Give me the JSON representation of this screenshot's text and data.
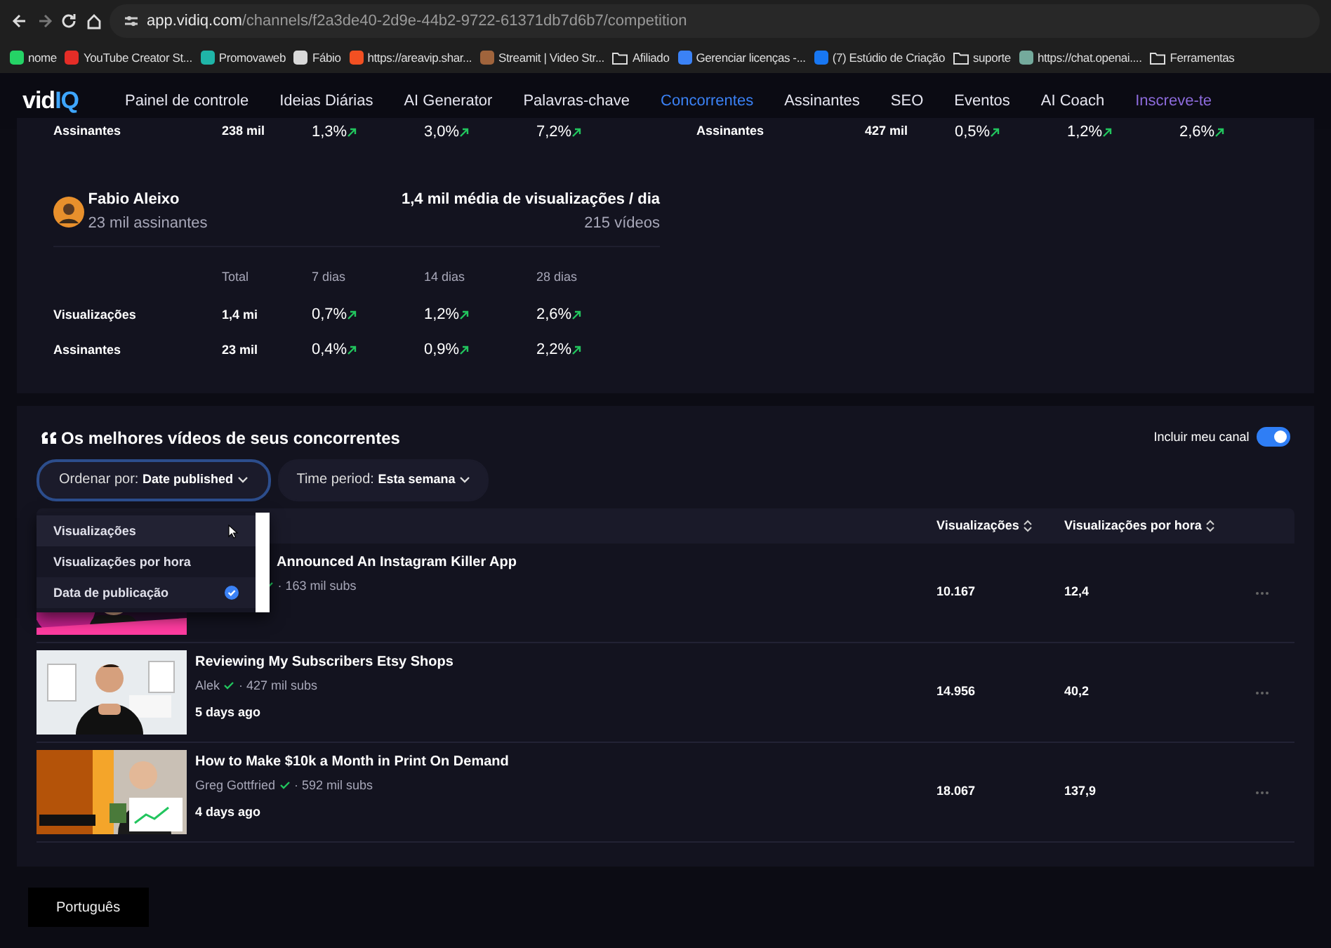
{
  "browser": {
    "url_host": "app.vidiq.com",
    "url_path": "/channels/f2a3de40-2d9e-44b2-9722-61371db7d6b7/competition"
  },
  "bookmarks": [
    {
      "label": "nome",
      "kind": "site",
      "color": "#25d366"
    },
    {
      "label": "YouTube Creator St...",
      "kind": "site",
      "color": "#e52d27"
    },
    {
      "label": "Promovaweb",
      "kind": "site",
      "color": "#1fb5a8"
    },
    {
      "label": "Fábio",
      "kind": "site",
      "color": "#d9d9d9"
    },
    {
      "label": "https://areavip.shar...",
      "kind": "site",
      "color": "#f25022"
    },
    {
      "label": "Streamit | Video Str...",
      "kind": "site",
      "color": "#a0643c"
    },
    {
      "label": "Afiliado",
      "kind": "folder"
    },
    {
      "label": "Gerenciar licenças -...",
      "kind": "site",
      "color": "#3b82f6"
    },
    {
      "label": "(7) Estúdio de Criação",
      "kind": "site",
      "color": "#1877f2"
    },
    {
      "label": "suporte",
      "kind": "folder"
    },
    {
      "label": "https://chat.openai....",
      "kind": "site",
      "color": "#74aa9c"
    },
    {
      "label": "Ferramentas",
      "kind": "folder"
    }
  ],
  "app": {
    "logo_main": "vid",
    "logo_accent": "IQ",
    "nav": [
      {
        "label": "Painel de controle",
        "kind": "link",
        "selected": false
      },
      {
        "label": "Ideias Diárias",
        "kind": "link",
        "selected": false
      },
      {
        "label": "AI Generator",
        "kind": "link",
        "selected": false
      },
      {
        "label": "Palavras-chave",
        "kind": "link",
        "selected": false
      },
      {
        "label": "Concorrentes",
        "kind": "link",
        "selected": true
      },
      {
        "label": "Assinantes",
        "kind": "link",
        "selected": false
      },
      {
        "label": "SEO",
        "kind": "link",
        "selected": false
      },
      {
        "label": "Eventos",
        "kind": "link",
        "selected": false
      },
      {
        "label": "AI Coach",
        "kind": "link",
        "selected": false
      },
      {
        "label": "Inscreve-te",
        "kind": "upgrade",
        "selected": false
      }
    ]
  },
  "partial_rows": [
    {
      "label": "Assinantes",
      "total": "238 mil",
      "values": [
        "1,3%",
        "3,0%",
        "7,2%"
      ]
    },
    {
      "label": "Assinantes",
      "total": "427 mil",
      "values": [
        "0,5%",
        "1,2%",
        "2,6%"
      ]
    }
  ],
  "channel": {
    "name": "Fabio Aleixo",
    "subscribers": "23 mil assinantes",
    "average": "1,4 mil média de visualizações / dia",
    "videos": "215 vídeos",
    "columns": [
      "Total",
      "7 dias",
      "14 dias",
      "28 dias"
    ],
    "rows": [
      {
        "label": "Visualizações",
        "total": "1,4 mi",
        "values": [
          "0,7%",
          "1,2%",
          "2,6%"
        ]
      },
      {
        "label": "Assinantes",
        "total": "23 mil",
        "values": [
          "0,4%",
          "0,9%",
          "2,2%"
        ]
      }
    ]
  },
  "top_videos": {
    "title": "Os melhores vídeos de seus concorrentes",
    "toggle": {
      "label": "Incluir meu canal",
      "on": true
    },
    "sort": {
      "label": "Ordenar por:",
      "value": "Date published"
    },
    "period": {
      "label": "Time period:",
      "value": "Esta semana"
    },
    "sort_menu": [
      {
        "label": "Visualizações",
        "hovered": true,
        "selected": false
      },
      {
        "label": "Visualizações por hora",
        "hovered": false,
        "selected": false
      },
      {
        "label": "Data de publicação",
        "hovered": false,
        "selected": true
      }
    ],
    "columns": [
      "Visualizações",
      "Visualizações por hora"
    ],
    "videos": [
      {
        "title": "Announced An Instagram Killer App",
        "subs": "· 163 mil subs",
        "views": "10.167",
        "per_hour": "12,4"
      },
      {
        "title": "Reviewing My Subscribers Etsy Shops",
        "channel": "Alek",
        "subs": "· 427 mil subs",
        "age": "5 days ago",
        "views": "14.956",
        "per_hour": "40,2"
      },
      {
        "title": "How to Make $10k a Month in Print On Demand",
        "channel": "Greg Gottfried",
        "subs": "· 592 mil subs",
        "age": "4 days ago",
        "views": "18.067",
        "per_hour": "137,9"
      }
    ]
  },
  "footer": {
    "language": "Português"
  }
}
